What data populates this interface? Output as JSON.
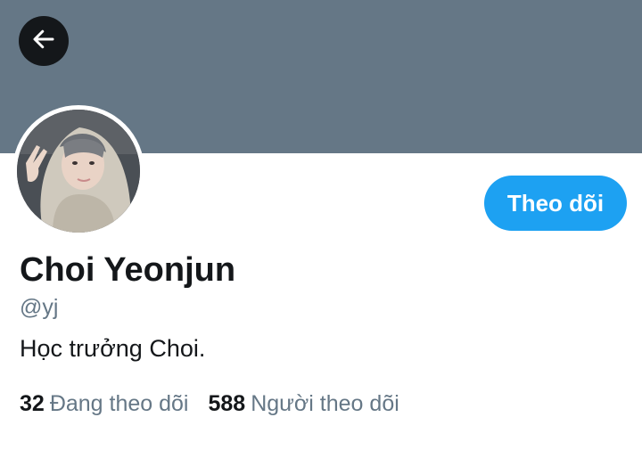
{
  "header": {
    "banner_color": "#657786",
    "back_icon": "arrow-left-icon"
  },
  "profile": {
    "display_name": "Choi Yeonjun",
    "handle": "@yj",
    "bio": "Học trưởng Choi.",
    "avatar": "avatar-photo"
  },
  "actions": {
    "follow_label": "Theo dõi",
    "accent_color": "#1da1f2"
  },
  "stats": {
    "following_count": "32",
    "following_label": "Đang theo dõi",
    "followers_count": "588",
    "followers_label": "Người theo dõi"
  }
}
